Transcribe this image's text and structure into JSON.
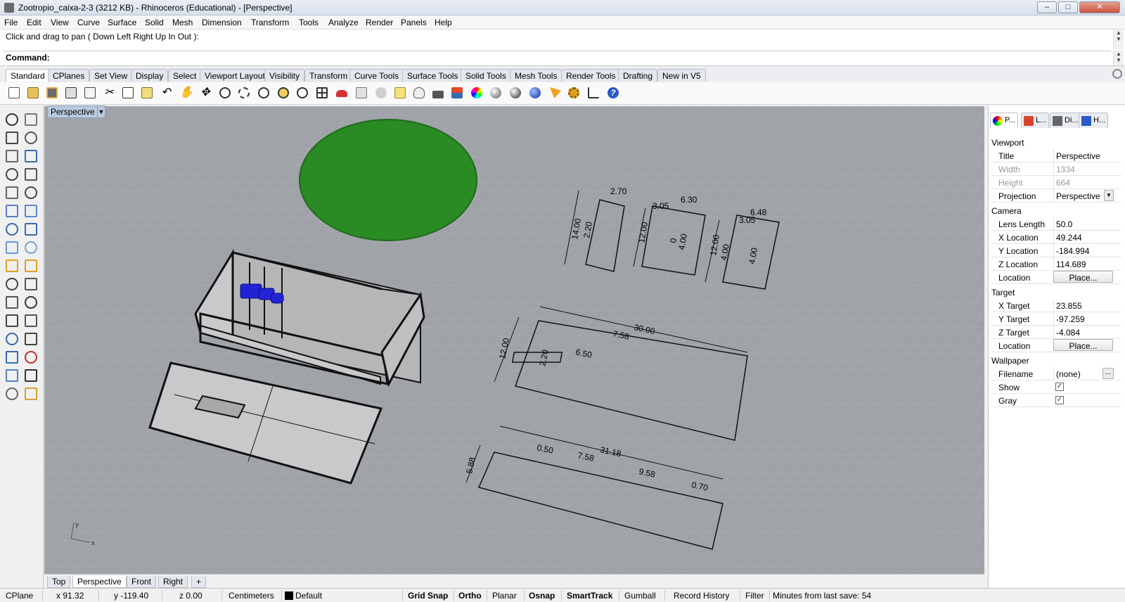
{
  "window": {
    "title": "Zootropio_caixa-2-3 (3212 KB) - Rhinoceros (Educational) - [Perspective]",
    "min_label": "–",
    "max_label": "□",
    "close_label": "✕"
  },
  "menu": [
    "File",
    "Edit",
    "View",
    "Curve",
    "Surface",
    "Solid",
    "Mesh",
    "Dimension",
    "Transform",
    "Tools",
    "Analyze",
    "Render",
    "Panels",
    "Help"
  ],
  "command": {
    "history": "Click and drag to pan ( Down  Left  Right  Up  In  Out ):",
    "prompt_label": "Command:",
    "value": ""
  },
  "toolbar_tabs": [
    "Standard",
    "CPlanes",
    "Set View",
    "Display",
    "Select",
    "Viewport Layout",
    "Visibility",
    "Transform",
    "Curve Tools",
    "Surface Tools",
    "Solid Tools",
    "Mesh Tools",
    "Render Tools",
    "Drafting",
    "New in V5"
  ],
  "toolbar_icons": [
    "new-file",
    "open-file",
    "save",
    "print",
    "import",
    "cut",
    "copy",
    "paste",
    "undo",
    "pan",
    "rotate-view",
    "zoom",
    "zoom-window",
    "zoom-extents",
    "zoom-selected",
    "rotate-camera",
    "four-viewports",
    "car-render",
    "block-manager",
    "car-shaded",
    "osnap",
    "point-snap",
    "light",
    "lock",
    "layer",
    "color-wheel",
    "shade-sphere",
    "ghost-sphere",
    "render-sphere",
    "lasso",
    "gear",
    "cplane",
    "help"
  ],
  "left_tools": [
    "select-arrow",
    "point",
    "polyline",
    "curve",
    "circle",
    "ellipse",
    "arc",
    "rectangle",
    "polygon",
    "fillet",
    "surface",
    "revolve",
    "box",
    "sphere",
    "cylinder",
    "mesh-plane",
    "gear-points",
    "explode",
    "split",
    "trim",
    "boolean",
    "orient",
    "offset",
    "extend",
    "text",
    "dimension",
    "array",
    "scale",
    "analyze",
    "check",
    "move",
    "rotate"
  ],
  "viewport": {
    "name": "Perspective",
    "dropdown": "▼",
    "axis_x": "x",
    "axis_y": "y",
    "dims": [
      "2.70",
      "14.00",
      "2.20",
      "6.30",
      "3.05",
      "12.00",
      "0",
      "4.00",
      "6.48",
      "3.05",
      "12.00",
      "4.00",
      "4.00",
      "30.00",
      "7.58",
      "12.00",
      "2.20",
      "6.50",
      "0.50",
      "31.18",
      "7.58",
      "5.88",
      "9.58",
      "0.70"
    ]
  },
  "view_tabs": [
    "Top",
    "Perspective",
    "Front",
    "Right",
    "+"
  ],
  "panel": {
    "tabs": [
      "P...",
      "L...",
      "Di...",
      "H..."
    ],
    "viewport_section": "Viewport",
    "title_label": "Title",
    "title_value": "Perspective",
    "width_label": "Width",
    "width_value": "1334",
    "height_label": "Height",
    "height_value": "664",
    "projection_label": "Projection",
    "projection_value": "Perspective",
    "camera_section": "Camera",
    "lens_label": "Lens Length",
    "lens_value": "50.0",
    "xloc_label": "X Location",
    "xloc_value": "49.244",
    "yloc_label": "Y Location",
    "yloc_value": "-184.994",
    "zloc_label": "Z Location",
    "zloc_value": "114.689",
    "loc_label": "Location",
    "place_label": "Place...",
    "target_section": "Target",
    "xt_label": "X Target",
    "xt_value": "23.855",
    "yt_label": "Y Target",
    "yt_value": "-97.259",
    "zt_label": "Z Target",
    "zt_value": "-4.084",
    "tloc_label": "Location",
    "tplace_label": "Place...",
    "wallpaper_section": "Wallpaper",
    "file_label": "Filename",
    "file_value": "(none)",
    "file_btn": "...",
    "show_label": "Show",
    "gray_label": "Gray",
    "check": "✓"
  },
  "status": {
    "cplane": "CPlane",
    "x": "x 91.32",
    "y": "y -119.40",
    "z": "z 0.00",
    "units": "Centimeters",
    "layer": "Default",
    "grid_snap": "Grid Snap",
    "ortho": "Ortho",
    "planar": "Planar",
    "osnap": "Osnap",
    "smarttrack": "SmartTrack",
    "gumball": "Gumball",
    "record_history": "Record History",
    "filter": "Filter",
    "save_info": "Minutes from last save: 54"
  },
  "colors": {
    "viewport_bg": "#9fa3a8",
    "disc": "#2a8a24",
    "part_fill": "#c9c9cb",
    "selected_part": "#2323d6"
  }
}
